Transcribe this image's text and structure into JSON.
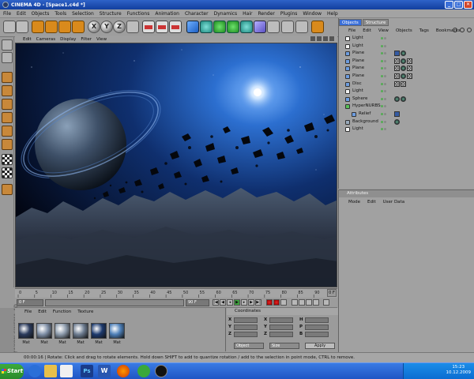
{
  "window": {
    "title": "CINEMA 4D - [Space1.c4d *]"
  },
  "menu": [
    "File",
    "Edit",
    "Objects",
    "Tools",
    "Selection",
    "Structure",
    "Functions",
    "Animation",
    "Character",
    "Dynamics",
    "Hair",
    "Render",
    "Plugins",
    "Window",
    "Help"
  ],
  "toolbar": {
    "x_label": "X",
    "y_label": "Y",
    "z_label": "Z"
  },
  "viewport": {
    "menu": [
      "Edit",
      "Cameras",
      "Display",
      "Filter",
      "View"
    ]
  },
  "timeline": {
    "ticks": [
      "0",
      "5",
      "10",
      "15",
      "20",
      "25",
      "30",
      "35",
      "40",
      "45",
      "50",
      "55",
      "60",
      "65",
      "70",
      "75",
      "80",
      "85",
      "90"
    ],
    "end_label": "0 F",
    "current_frame": "0 F",
    "end_frame": "90 F"
  },
  "materials": {
    "menu": [
      "File",
      "Edit",
      "Function",
      "Texture"
    ],
    "items": [
      {
        "label": "Mat",
        "color": "#2a3a5c"
      },
      {
        "label": "Mat",
        "color": "#7f8fa6"
      },
      {
        "label": "Mat",
        "color": "#8c9aab"
      },
      {
        "label": "Mat",
        "color": "#6d7c90"
      },
      {
        "label": "Mat",
        "color": "#1d3a6e"
      },
      {
        "label": "Mat",
        "color": "#4d7fb8"
      }
    ]
  },
  "coordinates": {
    "title": "Coordinates",
    "axes_left": [
      "X",
      "Y",
      "Z"
    ],
    "axes_mid": [
      "X",
      "Y",
      "Z"
    ],
    "axes_right": [
      "H",
      "P",
      "B"
    ],
    "object_mode": "Object",
    "size_mode": "Size",
    "apply_label": "Apply"
  },
  "status": {
    "text": "00:00:16 | Rotate: Click and drag to rotate elements. Hold down SHIFT to add to quantize rotation / add to the selection in point mode, CTRL to remove."
  },
  "objects_panel": {
    "tabs": [
      "Objects",
      "Structure"
    ],
    "menu": [
      "File",
      "Edit",
      "View",
      "Objects",
      "Tags",
      "Bookmarks"
    ],
    "items": [
      {
        "name": "Light",
        "indent": 0,
        "icon": "light-icon",
        "tags": []
      },
      {
        "name": "Light",
        "indent": 0,
        "icon": "light-icon",
        "tags": []
      },
      {
        "name": "Plane",
        "indent": 0,
        "icon": "plane-icon",
        "tags": [
          "bl",
          "dk"
        ]
      },
      {
        "name": "Plane",
        "indent": 0,
        "icon": "plane-icon",
        "tags": [
          "chk",
          "dk",
          "chk"
        ]
      },
      {
        "name": "Plane",
        "indent": 0,
        "icon": "plane-icon",
        "tags": [
          "chk",
          "dk",
          "chk"
        ]
      },
      {
        "name": "Plane",
        "indent": 0,
        "icon": "plane-icon",
        "tags": [
          "chk",
          "dk",
          "chk"
        ]
      },
      {
        "name": "Disc",
        "indent": 0,
        "icon": "disc-icon",
        "tags": [
          "chk",
          "chk"
        ]
      },
      {
        "name": "Light",
        "indent": 0,
        "icon": "light-icon",
        "tags": []
      },
      {
        "name": "Sphere",
        "indent": 0,
        "icon": "sphere-icon",
        "tags": [
          "dk",
          "dk"
        ]
      },
      {
        "name": "HyperNURBS",
        "indent": 0,
        "icon": "hypernurbs-icon",
        "tags": []
      },
      {
        "name": "Relief",
        "indent": 1,
        "icon": "relief-icon",
        "tags": [
          "bl"
        ]
      },
      {
        "name": "Background",
        "indent": 0,
        "icon": "background-icon",
        "tags": [
          "dk"
        ]
      },
      {
        "name": "Light",
        "indent": 0,
        "icon": "light-icon",
        "tags": []
      }
    ]
  },
  "attributes_panel": {
    "title": "Attributes",
    "menu": [
      "Mode",
      "Edit",
      "User Data"
    ]
  },
  "taskbar": {
    "start_label": "Start",
    "time": "15:23",
    "date": "10.12.2009"
  }
}
